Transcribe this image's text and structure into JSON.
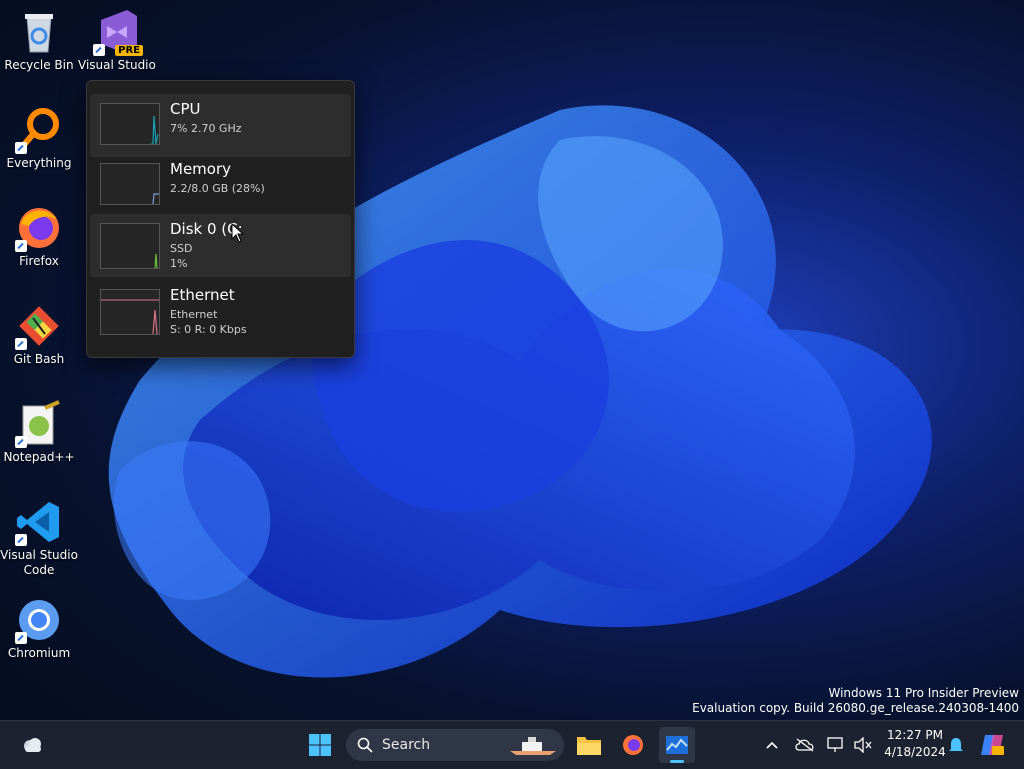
{
  "desktop": {
    "icons": [
      {
        "label": "Recycle Bin",
        "icon": "recycle-bin-icon"
      },
      {
        "label": "Visual Studio 2022 Preview",
        "badge": "PRE",
        "icon": "visual-studio-icon"
      },
      {
        "label": "Everything",
        "icon": "everything-search-icon"
      },
      {
        "label": "Firefox",
        "icon": "firefox-icon"
      },
      {
        "label": "Git Bash",
        "icon": "git-bash-icon"
      },
      {
        "label": "Notepad++",
        "icon": "notepad-plus-plus-icon"
      },
      {
        "label": "Visual Studio Code",
        "icon": "vscode-icon"
      },
      {
        "label": "Chromium",
        "icon": "chromium-icon"
      }
    ]
  },
  "flyout": {
    "items": [
      {
        "name": "CPU",
        "line2": "7% 2.70 GHz",
        "line3": ""
      },
      {
        "name": "Memory",
        "line2": "2.2/8.0 GB (28%)",
        "line3": ""
      },
      {
        "name": "Disk 0 (C:",
        "line2": "SSD",
        "line3": "1%"
      },
      {
        "name": "Ethernet",
        "line2": "Ethernet",
        "line3": "S: 0 R: 0 Kbps"
      }
    ]
  },
  "watermark": {
    "line1": "Windows 11 Pro Insider Preview",
    "line2": "Evaluation copy. Build 26080.ge_release.240308-1400"
  },
  "taskbar": {
    "search_label": "Search",
    "time": "12:27 PM",
    "date": "4/18/2024"
  },
  "colors": {
    "accent": "#3b82f6",
    "cpu_graph": "#17a2b8",
    "memory_graph": "#7b9fd6",
    "disk_graph": "#6cbf3a",
    "ethernet_graph": "#d9748a"
  }
}
